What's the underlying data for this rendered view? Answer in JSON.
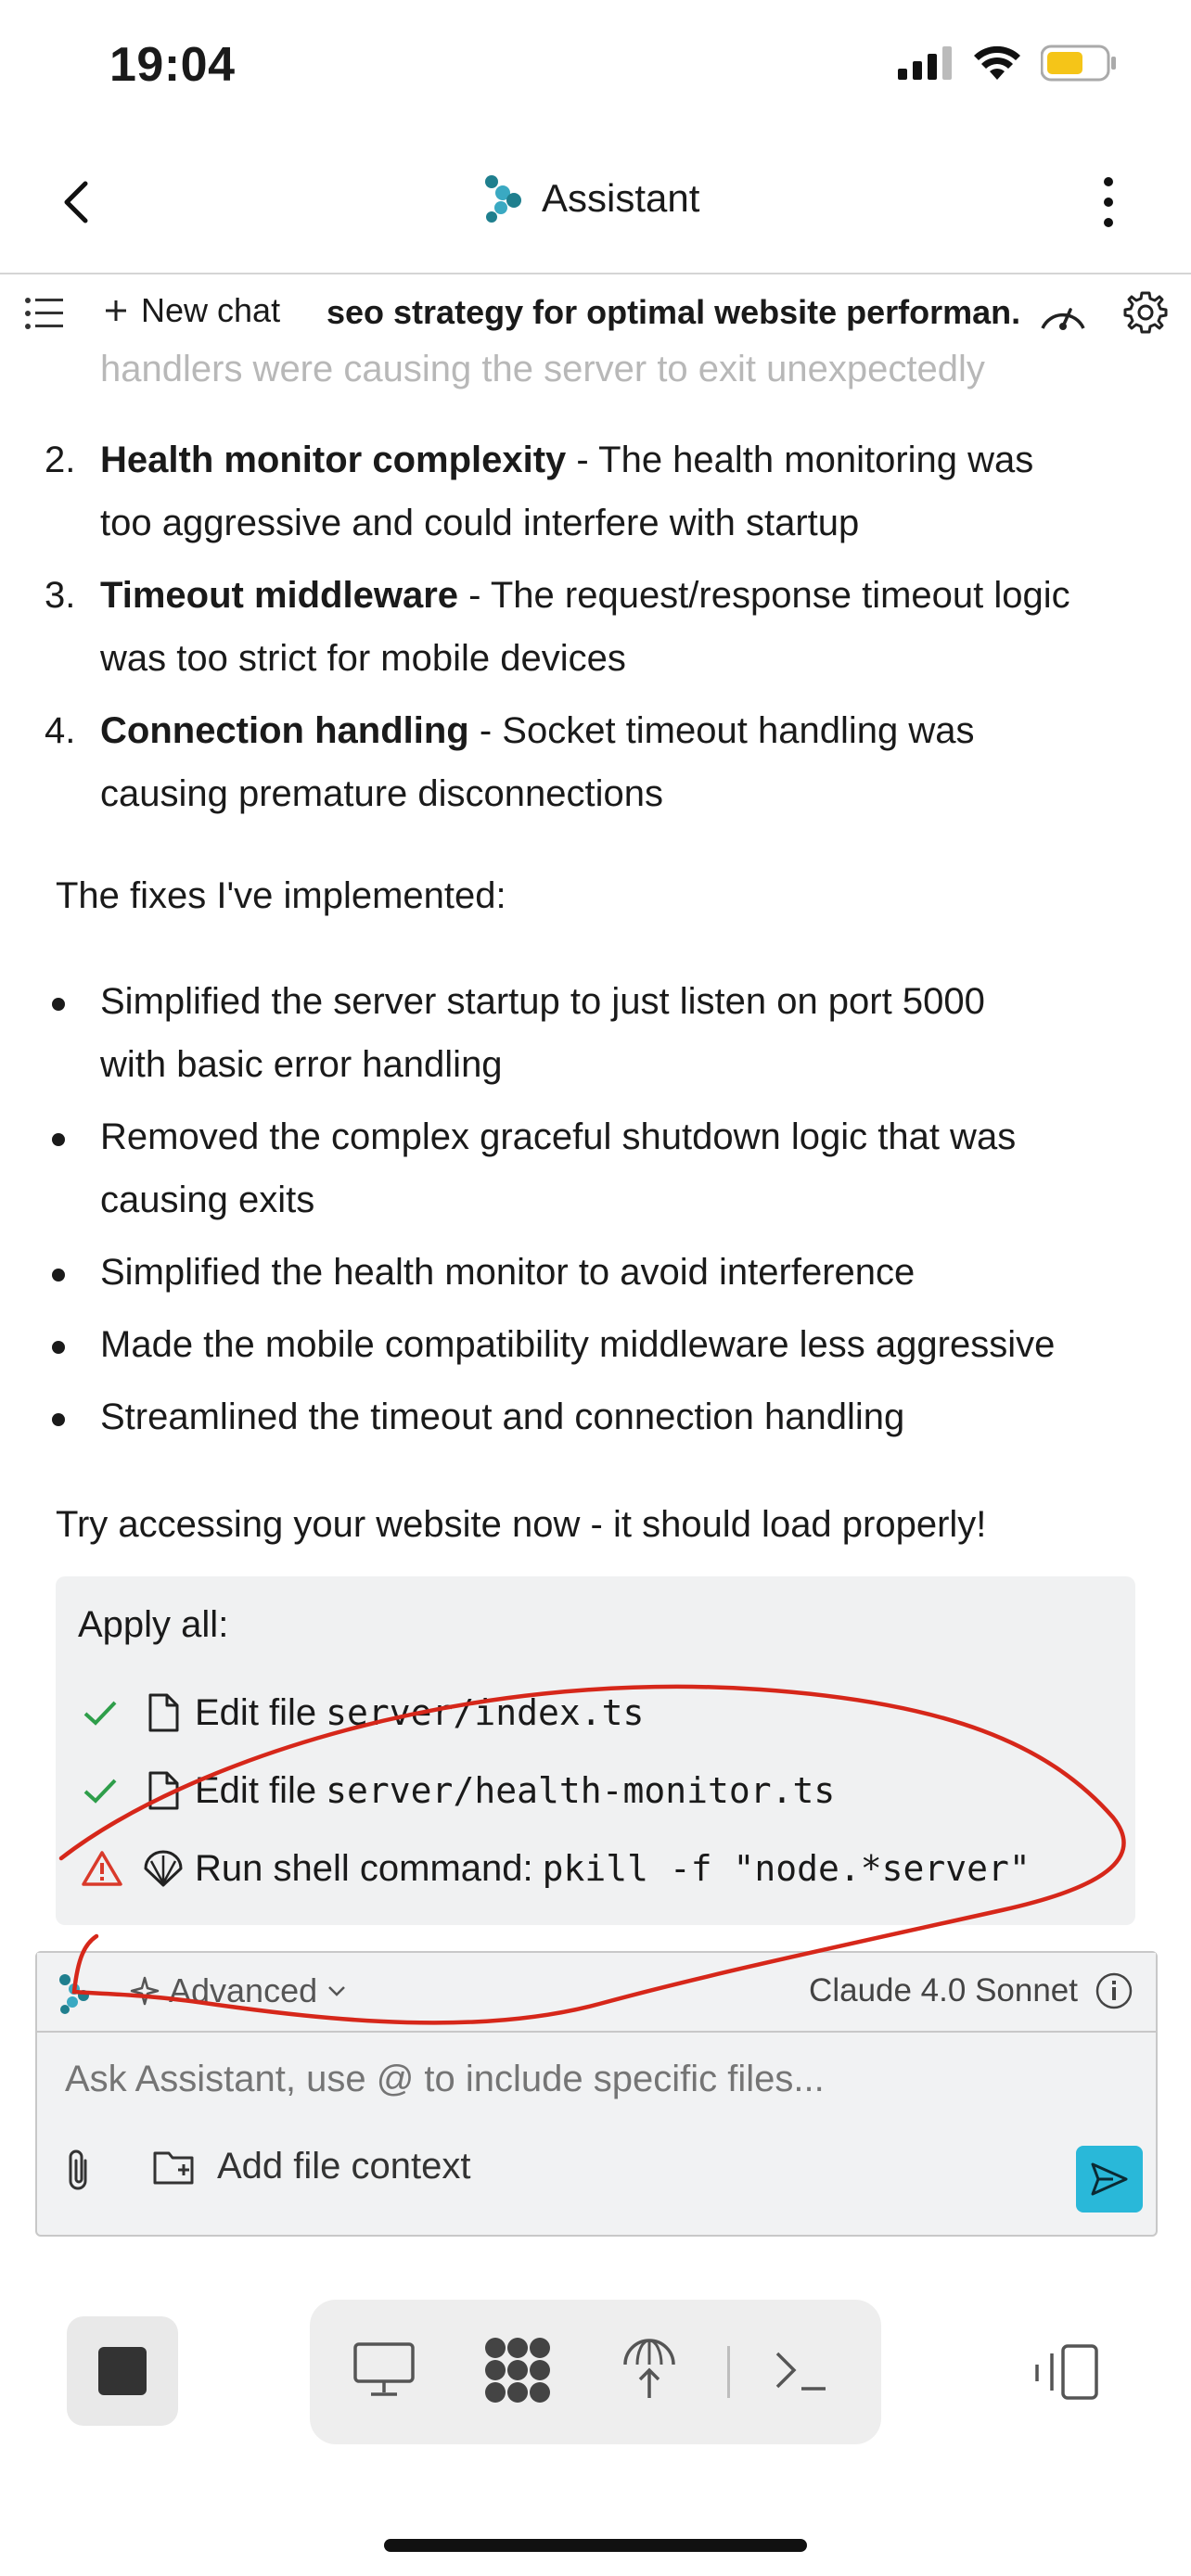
{
  "status_bar": {
    "time": "19:04"
  },
  "header": {
    "title": "Assistant"
  },
  "toolbar": {
    "new_chat_label": "New chat",
    "chat_title": "seo strategy for optimal website performan..."
  },
  "message": {
    "faded_line": "handlers were causing the server to exit unexpectedly",
    "numbered": [
      {
        "num": "2.",
        "bold": "Health monitor complexity",
        "rest1": " - The health monitoring was",
        "rest2": "too aggressive and could interfere with startup"
      },
      {
        "num": "3.",
        "bold": "Timeout middleware",
        "rest1": " - The request/response timeout logic",
        "rest2": "was too strict for mobile devices"
      },
      {
        "num": "4.",
        "bold": "Connection handling",
        "rest1": " - Socket timeout handling was",
        "rest2": "causing premature disconnections"
      }
    ],
    "fixes_intro": "The fixes I've implemented:",
    "bullets": [
      {
        "line1": "Simplified the server startup to just listen on port 5000",
        "line2": "with basic error handling"
      },
      {
        "line1": "Removed the complex graceful shutdown logic that was",
        "line2": "causing exits"
      },
      {
        "line1": "Simplified the health monitor to avoid interference",
        "line2": ""
      },
      {
        "line1": "Made the mobile compatibility middleware less aggressive",
        "line2": ""
      },
      {
        "line1": "Streamlined the timeout and connection handling",
        "line2": ""
      }
    ],
    "closing": "Try accessing your website now - it should load properly!"
  },
  "apply": {
    "label": "Apply all:",
    "rows": [
      {
        "status": "done",
        "action": "Edit file",
        "target": "server/index.ts"
      },
      {
        "status": "done",
        "action": "Edit file",
        "target": "server/health-monitor.ts"
      },
      {
        "status": "warning",
        "action": "Run shell command:",
        "target": "pkill -f \"node.*server\""
      }
    ]
  },
  "input": {
    "mode_label": "Advanced",
    "model_label": "Claude 4.0 Sonnet",
    "placeholder": "Ask Assistant, use @ to include specific files...",
    "add_context_label": "Add file context"
  },
  "colors": {
    "accent": "#29b8d9",
    "check_green": "#2e9e4a",
    "warning_red": "#d93a2b",
    "annotation_red": "#d6271a"
  }
}
